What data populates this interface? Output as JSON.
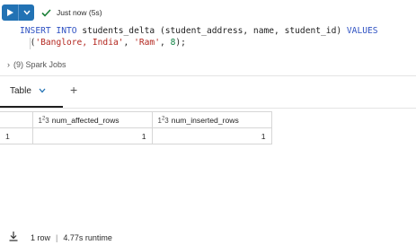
{
  "cell": {
    "status_text": "Just now (5s)",
    "code_line1": {
      "kw_insert": "INSERT INTO",
      "table": " students_delta (student_address, name, student_id) ",
      "kw_values": "VALUES"
    },
    "code_line2": {
      "open": "(",
      "str1": "'Banglore, India'",
      "comma1": ", ",
      "str2": "'Ram'",
      "comma2": ", ",
      "num": "8",
      "close": ");"
    },
    "spark_jobs_label": "(9) Spark Jobs"
  },
  "tabs": [
    {
      "label": "Table",
      "active": true
    }
  ],
  "table": {
    "columns": [
      {
        "type_icon": "1²3",
        "label": "num_affected_rows"
      },
      {
        "type_icon": "1²3",
        "label": "num_inserted_rows"
      }
    ],
    "rows": [
      {
        "index": "1",
        "values": [
          "1",
          "1"
        ]
      }
    ]
  },
  "footer": {
    "row_count": "1 row",
    "separator": "|",
    "runtime": "4.77s runtime"
  },
  "colors": {
    "accent": "#2272b4",
    "success": "#1a7f37",
    "keyword": "#2e51c2",
    "string": "#b3261e",
    "number": "#0a7f3f"
  },
  "icons": {
    "run": "play-icon",
    "run_options": "chevron-down-icon",
    "status": "check-icon",
    "spark_toggle": "chevron-right-icon",
    "tab_menu": "chevron-down-icon",
    "add_tab": "plus-icon",
    "download": "download-icon"
  }
}
